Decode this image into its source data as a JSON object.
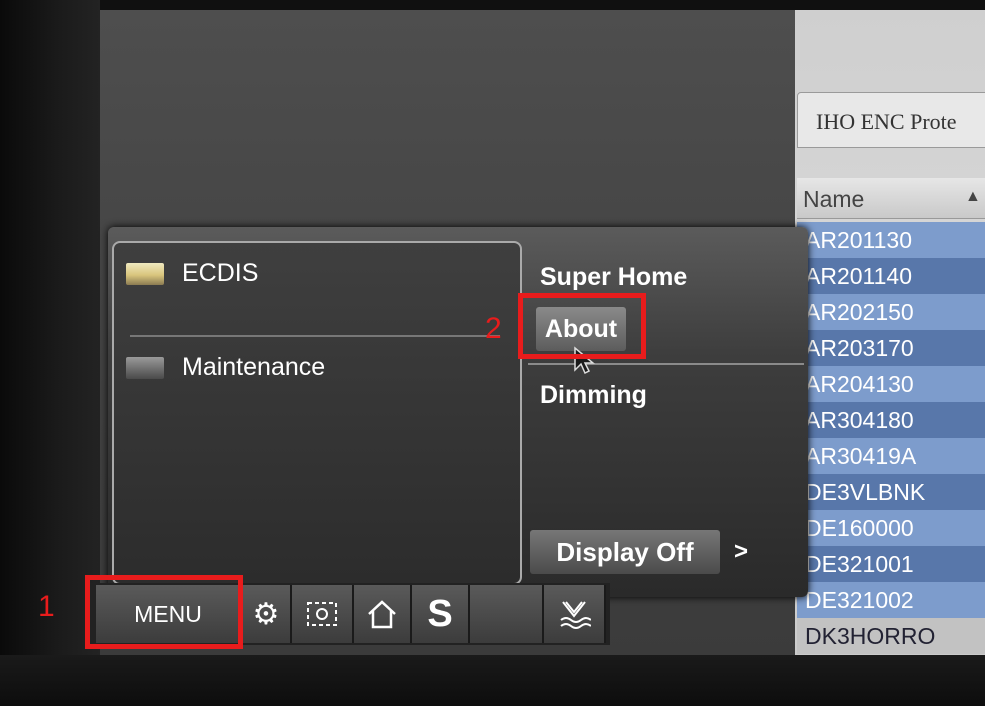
{
  "menu": {
    "left_items": [
      {
        "label": "ECDIS",
        "icon": "ecdis-app-icon"
      },
      {
        "label": "Maintenance",
        "icon": "maintenance-app-icon"
      }
    ],
    "right_items": {
      "super_home": "Super Home",
      "about": "About",
      "dimming": "Dimming",
      "display_off": "Display Off",
      "display_off_arrow": ">"
    }
  },
  "taskbar": {
    "menu_label": "MENU",
    "s_label": "S",
    "icons": [
      "gear-icon",
      "target-icon",
      "home-icon",
      "s-icon",
      "blank",
      "anchor-icon"
    ]
  },
  "list_panel": {
    "tab_label": "IHO ENC Prote",
    "column_header": "Name",
    "sort_indicator": "▲",
    "rows": [
      "AR201130",
      "AR201140",
      "AR202150",
      "AR203170",
      "AR204130",
      "AR304180",
      "AR30419A",
      "DE3VLBNK",
      "DE160000",
      "DE321001",
      "DE321002",
      "DK3HORRO"
    ]
  },
  "annotations": {
    "callout_1": "1",
    "callout_2": "2",
    "highlight_color": "#e81c1c"
  }
}
